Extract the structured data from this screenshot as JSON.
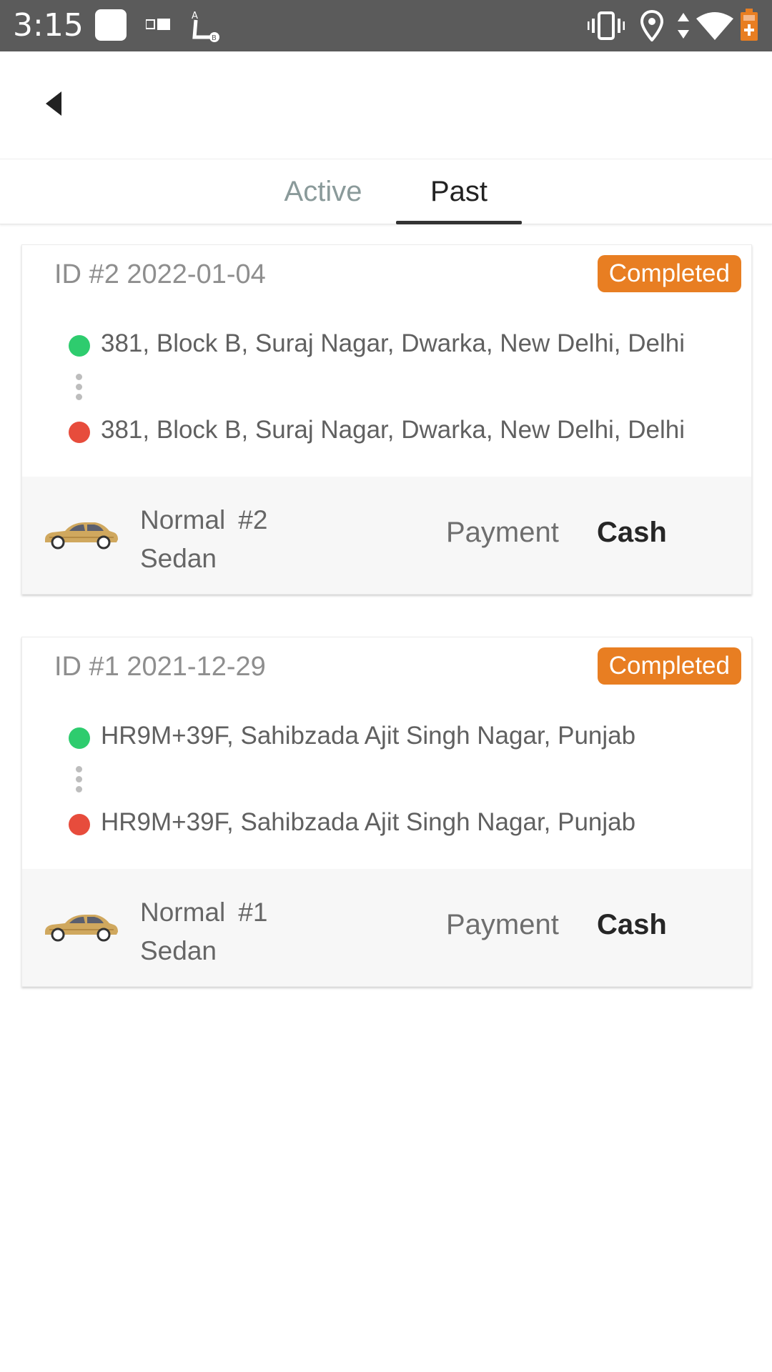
{
  "status_bar": {
    "time": "3:15",
    "icons": [
      "square-notification-icon",
      "sim-icon",
      "route-ab-icon",
      "vibrate-icon",
      "location-icon",
      "data-arrows-icon",
      "wifi-icon",
      "battery-icon"
    ]
  },
  "app_bar": {
    "back_icon": "back-arrow-icon"
  },
  "tabs": [
    {
      "label": "Active",
      "selected": false
    },
    {
      "label": "Past",
      "selected": true
    }
  ],
  "trips": [
    {
      "id_label": "ID #2 2022-01-04",
      "status": "Completed",
      "pickup": "381, Block B, Suraj Nagar, Dwarka, New Delhi, Delhi",
      "drop": "381, Block B, Suraj Nagar, Dwarka, New Delhi, Delhi",
      "vehicle_class": "Normal",
      "vehicle_number": "#2",
      "vehicle_type": "Sedan",
      "payment_label": "Payment",
      "payment_method": "Cash"
    },
    {
      "id_label": "ID #1 2021-12-29",
      "status": "Completed",
      "pickup": "HR9M+39F, Sahibzada Ajit Singh Nagar, Punjab",
      "drop": "HR9M+39F, Sahibzada Ajit Singh Nagar, Punjab",
      "vehicle_class": "Normal",
      "vehicle_number": "#1",
      "vehicle_type": "Sedan",
      "payment_label": "Payment",
      "payment_method": "Cash"
    }
  ],
  "colors": {
    "status_badge": "#e87e22",
    "pickup_dot": "#2ecc6e",
    "drop_dot": "#e74c3c",
    "status_bar": "#5b5b5b"
  }
}
